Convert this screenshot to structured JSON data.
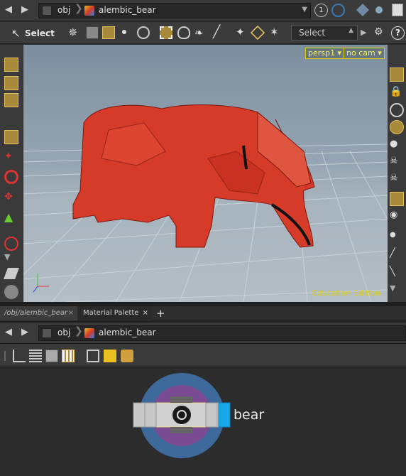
{
  "top_path": {
    "root": "obj",
    "node": "alembic_bear",
    "badge": "1"
  },
  "toolbar": {
    "select_label": "Select",
    "dropdown_value": "Select",
    "help": "?"
  },
  "viewport": {
    "camera_view": "persp1",
    "camera": "no cam",
    "edition": "Education Edition"
  },
  "tabs": [
    {
      "label": "/obj/alembic_bear"
    },
    {
      "label": "Material Palette"
    }
  ],
  "network_path": {
    "root": "obj",
    "node": "alembic_bear"
  },
  "node": {
    "name": "bear"
  },
  "colors": {
    "accent": "#d8d000",
    "active_tool": "#a88a3a",
    "bear": "#d63a28",
    "node_flag": "#1aa7e8"
  }
}
